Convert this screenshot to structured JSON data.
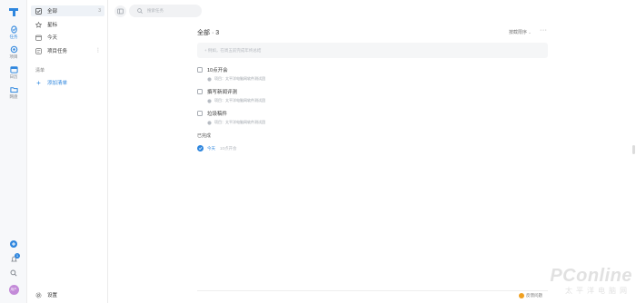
{
  "rail": {
    "items": [
      {
        "label": "任务",
        "icon": "task-icon",
        "active": true
      },
      {
        "label": "项目",
        "icon": "project-icon"
      },
      {
        "label": "日历",
        "icon": "calendar-icon"
      },
      {
        "label": "网盘",
        "icon": "drive-icon"
      }
    ],
    "notification_count": "1",
    "avatar_text": "用户"
  },
  "sidebar": {
    "items": [
      {
        "label": "全部",
        "count": "3",
        "icon": "check-square-icon",
        "active": true
      },
      {
        "label": "星标",
        "icon": "star-icon"
      },
      {
        "label": "今天",
        "icon": "calendar-today-icon"
      },
      {
        "label": "项目任务",
        "icon": "folder-icon"
      }
    ],
    "list_section": "清单",
    "add_list": "添加清单",
    "settings": "设置"
  },
  "search": {
    "placeholder": "搜索任务"
  },
  "header": {
    "title": "全部 · 3",
    "sort": "按截限序",
    "more": "···"
  },
  "add_task": {
    "placeholder": "+ 例如，在周五前完成年终总结"
  },
  "tasks": [
    {
      "title": "10点开会",
      "project": "项目：太平洋电脑网软件测试团"
    },
    {
      "title": "撰写新闻评测",
      "project": "项目：太平洋电脑网软件测试团"
    },
    {
      "title": "垃圾稿件",
      "project": "项目：太平洋电脑网软件测试团"
    }
  ],
  "completed": {
    "header": "已完成",
    "items": [
      {
        "date": "今天",
        "title": "10点开会"
      }
    ]
  },
  "footer": {
    "feedback": "反馈问题"
  },
  "watermark": {
    "main": "PConline",
    "sub": "太平洋电脑网"
  },
  "colors": {
    "accent": "#2e86de",
    "rail_bg": "#f7f8fa",
    "active_bg": "#eef2f7"
  }
}
